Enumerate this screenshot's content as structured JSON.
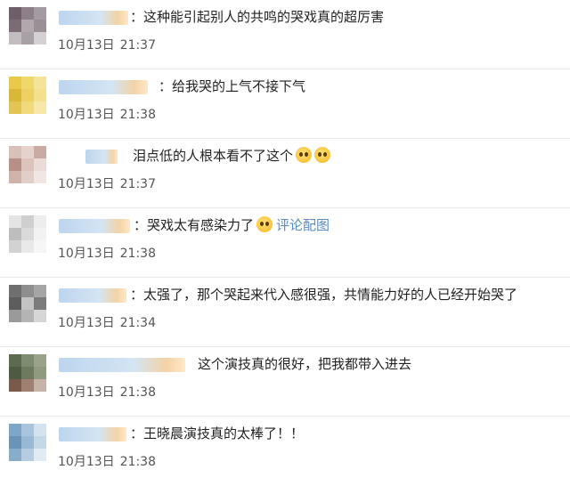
{
  "comments": [
    {
      "text": "：这种能引起别人的共鸣的哭戏真的超厉害",
      "date": "10月13日",
      "time": "21:37",
      "emojis": 0,
      "link": ""
    },
    {
      "text": "：给我哭的上气不接下气",
      "date": "10月13日",
      "time": "21:38",
      "emojis": 0,
      "link": ""
    },
    {
      "text": "泪点低的人根本看不了这个",
      "date": "10月13日",
      "time": "21:37",
      "emojis": 2,
      "link": ""
    },
    {
      "text": "：哭戏太有感染力了",
      "date": "10月13日",
      "time": "21:38",
      "emojis": 1,
      "link": "评论配图"
    },
    {
      "text": "：太强了，那个哭起来代入感很强，共情能力好的人已经开始哭了",
      "date": "10月13日",
      "time": "21:34",
      "emojis": 0,
      "link": ""
    },
    {
      "text": "这个演技真的很好，把我都带入进去",
      "date": "10月13日",
      "time": "21:38",
      "emojis": 0,
      "link": ""
    },
    {
      "text": "：王晓晨演技真的太棒了！！",
      "date": "10月13日",
      "time": "21:38",
      "emojis": 0,
      "link": ""
    }
  ],
  "icons": {
    "emoji": "crying-face-emoji",
    "avatar": "blurred-avatar"
  },
  "colors": {
    "link": "#5a8bc4",
    "divider": "#e8e8e8",
    "meta": "#555555"
  }
}
